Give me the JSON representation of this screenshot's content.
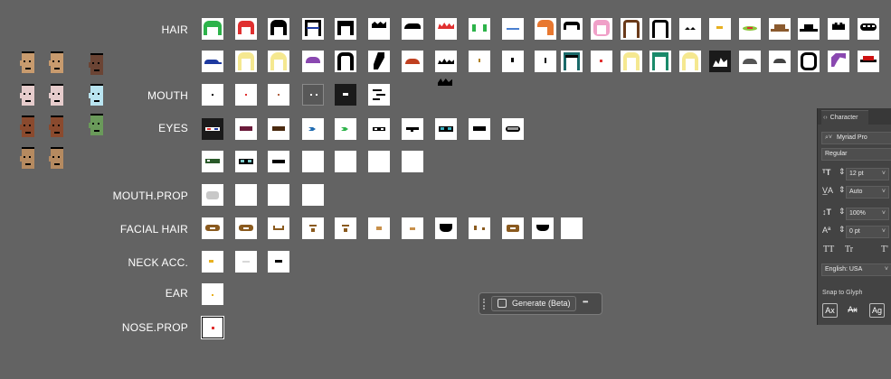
{
  "labels": {
    "hair": "HAIR",
    "mouth": "MOUTH",
    "eyes": "EYES",
    "mouth_prop": "MOUTH.PROP",
    "facial_hair": "FACIAL HAIR",
    "neck_acc": "NECK ACC.",
    "ear": "EAR",
    "nose_prop": "NOSE.PROP"
  },
  "generate": {
    "label": "Generate (Beta)",
    "more": "•••"
  },
  "character_panel": {
    "tab": "Character",
    "font_family": "Myriad Pro",
    "font_style": "Regular",
    "font_size": "12 pt",
    "leading": "Auto",
    "vertical_scale": "100%",
    "baseline": "0 pt",
    "tt_labels": [
      "TT",
      "Tr",
      "T'"
    ],
    "language": "English: USA",
    "snap_label": "Snap to Glyph"
  },
  "colors": {
    "canvas": "#636363",
    "panel": "#434343",
    "skin_tan": "#c89b6e",
    "skin_pale": "#e6cccc",
    "skin_dark": "#6b4434",
    "skin_blue": "#b9e4f0",
    "skin_green": "#6a9a5a"
  }
}
